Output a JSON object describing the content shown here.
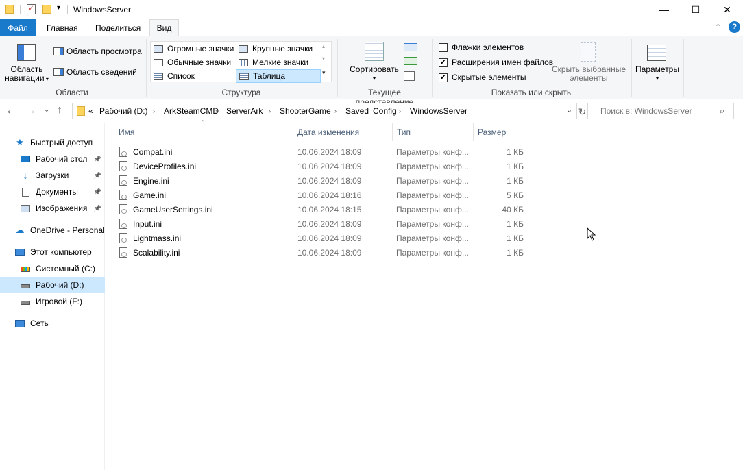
{
  "window": {
    "title": "WindowsServer",
    "minimize": "—",
    "maximize": "☐",
    "close": "✕"
  },
  "ribbon_tabs": [
    "Файл",
    "Главная",
    "Поделиться",
    "Вид"
  ],
  "ribbon": {
    "panes": {
      "nav_pane_line1": "Область",
      "nav_pane_line2": "навигации",
      "preview": "Область просмотра",
      "details": "Область сведений",
      "group": "Области"
    },
    "layout": {
      "items": [
        "Огромные значки",
        "Крупные значки",
        "Обычные значки",
        "Мелкие значки",
        "Список",
        "Таблица"
      ],
      "selected": "Таблица",
      "group": "Структура"
    },
    "current_view": {
      "sort": "Сортировать",
      "group": "Текущее представление"
    },
    "show_hide": {
      "checkboxes": [
        {
          "label": "Флажки элементов",
          "checked": false
        },
        {
          "label": "Расширения имен файлов",
          "checked": true
        },
        {
          "label": "Скрытые элементы",
          "checked": true
        }
      ],
      "hide_selected_line1": "Скрыть выбранные",
      "hide_selected_line2": "элементы",
      "group": "Показать или скрыть"
    },
    "options": "Параметры"
  },
  "address": {
    "prefix": "«",
    "crumbs": [
      "Рабочий (D:)",
      "ArkSteamCMD",
      "ServerArk",
      "ShooterGame",
      "Saved",
      "Config",
      "WindowsServer"
    ],
    "search_placeholder": "Поиск в: WindowsServer"
  },
  "nav": [
    {
      "label": "Быстрый доступ",
      "icon": "star-icon",
      "level": 0,
      "pinned": false
    },
    {
      "label": "Рабочий стол",
      "icon": "desktop-icon",
      "level": 1,
      "pinned": true
    },
    {
      "label": "Загрузки",
      "icon": "download-icon",
      "level": 1,
      "pinned": true
    },
    {
      "label": "Документы",
      "icon": "document-icon",
      "level": 1,
      "pinned": true
    },
    {
      "label": "Изображения",
      "icon": "pictures-icon",
      "level": 1,
      "pinned": true
    },
    {
      "label": "OneDrive - Personal",
      "icon": "cloud-icon",
      "level": 0,
      "pinned": false
    },
    {
      "label": "Этот компьютер",
      "icon": "computer-icon",
      "level": 0,
      "pinned": false
    },
    {
      "label": "Системный (C:)",
      "icon": "drive-icon",
      "level": 1,
      "pinned": false
    },
    {
      "label": "Рабочий (D:)",
      "icon": "drive-icon",
      "level": 1,
      "pinned": false,
      "selected": true
    },
    {
      "label": "Игровой (F:)",
      "icon": "drive-icon",
      "level": 1,
      "pinned": false
    },
    {
      "label": "Сеть",
      "icon": "network-icon",
      "level": 0,
      "pinned": false
    }
  ],
  "columns": [
    "Имя",
    "Дата изменения",
    "Тип",
    "Размер"
  ],
  "files": [
    {
      "name": "Compat.ini",
      "date": "10.06.2024 18:09",
      "type": "Параметры конф...",
      "size": "1 КБ"
    },
    {
      "name": "DeviceProfiles.ini",
      "date": "10.06.2024 18:09",
      "type": "Параметры конф...",
      "size": "1 КБ"
    },
    {
      "name": "Engine.ini",
      "date": "10.06.2024 18:09",
      "type": "Параметры конф...",
      "size": "1 КБ"
    },
    {
      "name": "Game.ini",
      "date": "10.06.2024 18:16",
      "type": "Параметры конф...",
      "size": "5 КБ"
    },
    {
      "name": "GameUserSettings.ini",
      "date": "10.06.2024 18:15",
      "type": "Параметры конф...",
      "size": "40 КБ"
    },
    {
      "name": "Input.ini",
      "date": "10.06.2024 18:09",
      "type": "Параметры конф...",
      "size": "1 КБ"
    },
    {
      "name": "Lightmass.ini",
      "date": "10.06.2024 18:09",
      "type": "Параметры конф...",
      "size": "1 КБ"
    },
    {
      "name": "Scalability.ini",
      "date": "10.06.2024 18:09",
      "type": "Параметры конф...",
      "size": "1 КБ"
    }
  ],
  "colors": {
    "file_tab": "#1979ca",
    "selection": "#cce8ff",
    "help": "#1979ca"
  }
}
